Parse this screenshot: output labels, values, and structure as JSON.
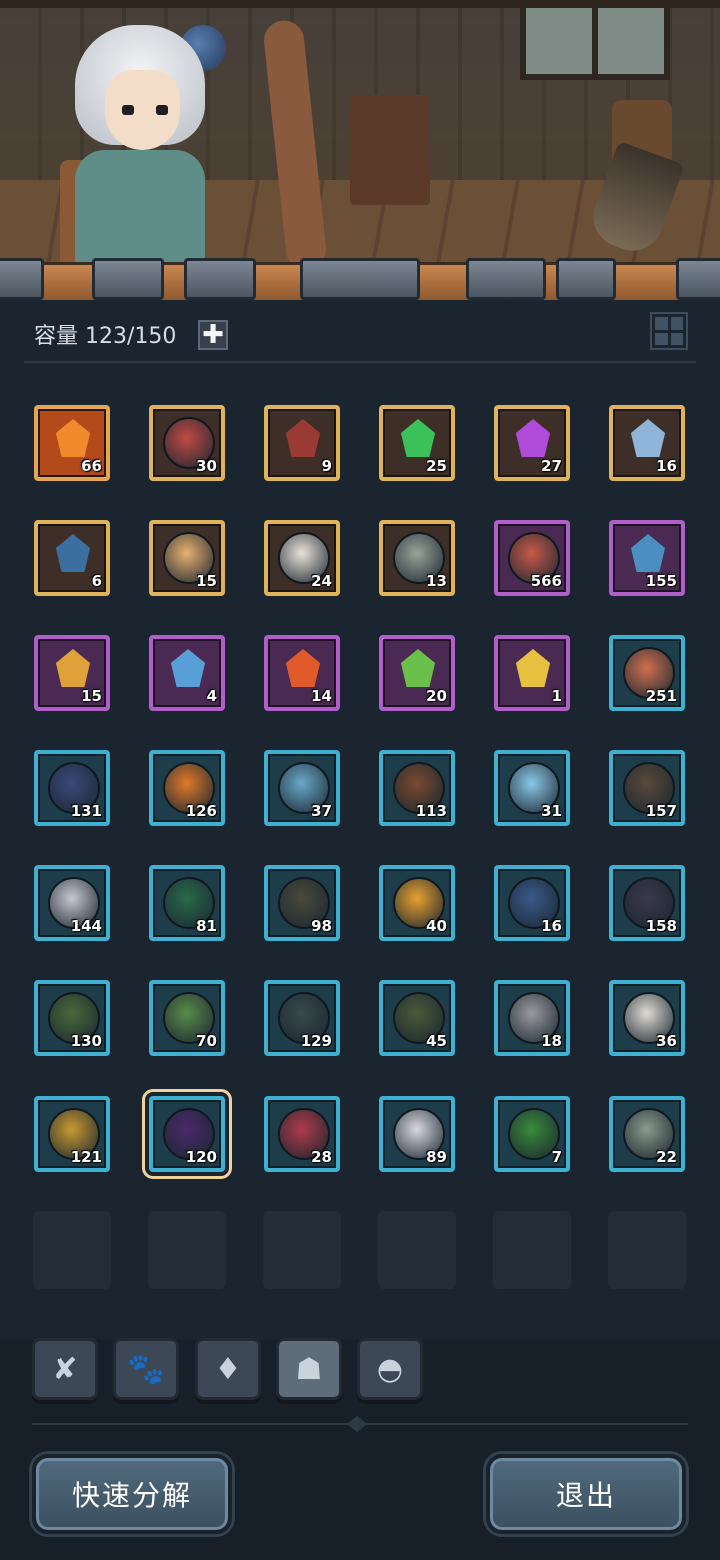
{
  "header": {
    "capacity_label": "容量 123/150",
    "add_symbol": "✚"
  },
  "tabs": [
    {
      "name": "weapon-icon",
      "glyph": "✘"
    },
    {
      "name": "paw-icon",
      "glyph": "🐾"
    },
    {
      "name": "diamond-icon",
      "glyph": "♦"
    },
    {
      "name": "material-icon",
      "glyph": "☗"
    },
    {
      "name": "chest-icon",
      "glyph": "◓"
    }
  ],
  "active_tab": 3,
  "items": [
    {
      "rarity": "orange",
      "kind": "fire-essence",
      "color": "#f08a2c",
      "shape": "gem",
      "count": "66"
    },
    {
      "rarity": "gold",
      "kind": "meat-stack",
      "color": "#c24a44",
      "shape": "orb",
      "count": "30"
    },
    {
      "rarity": "gold",
      "kind": "red-ore",
      "color": "#9a3a35",
      "shape": "gem",
      "count": "9"
    },
    {
      "rarity": "gold",
      "kind": "green-crystal",
      "color": "#3cc05a",
      "shape": "gem",
      "count": "25"
    },
    {
      "rarity": "gold",
      "kind": "purple-flame",
      "color": "#b04ad8",
      "shape": "gem",
      "count": "27"
    },
    {
      "rarity": "gold",
      "kind": "blue-shard",
      "color": "#8fb6d8",
      "shape": "gem",
      "count": "16"
    },
    {
      "rarity": "gold",
      "kind": "blue-star-crystal",
      "color": "#3a6fa0",
      "shape": "gem",
      "count": "6"
    },
    {
      "rarity": "gold",
      "kind": "hero-girl-portrait",
      "color": "#e8b070",
      "shape": "orb",
      "count": "15"
    },
    {
      "rarity": "gold",
      "kind": "white-hero-portrait",
      "color": "#e9e3d9",
      "shape": "orb",
      "count": "24"
    },
    {
      "rarity": "gold",
      "kind": "rat-portrait",
      "color": "#9aa49a",
      "shape": "orb",
      "count": "13"
    },
    {
      "rarity": "purple",
      "kind": "meat-drumstick",
      "color": "#c85a48",
      "shape": "orb",
      "count": "566"
    },
    {
      "rarity": "purple",
      "kind": "map-scroll",
      "color": "#4a8fc0",
      "shape": "gem",
      "count": "155"
    },
    {
      "rarity": "purple",
      "kind": "amber-ore",
      "color": "#e0a03a",
      "shape": "gem",
      "count": "15"
    },
    {
      "rarity": "purple",
      "kind": "water-drop",
      "color": "#5aa0d8",
      "shape": "gem",
      "count": "4"
    },
    {
      "rarity": "purple",
      "kind": "fire-essence",
      "color": "#e05a2a",
      "shape": "gem",
      "count": "14"
    },
    {
      "rarity": "purple",
      "kind": "green-crystal",
      "color": "#6ac04a",
      "shape": "gem",
      "count": "20"
    },
    {
      "rarity": "purple",
      "kind": "gold-star",
      "color": "#e8c040",
      "shape": "gem",
      "count": "1"
    },
    {
      "rarity": "teal",
      "kind": "meat-drumstick",
      "color": "#d07050",
      "shape": "orb",
      "count": "251"
    },
    {
      "rarity": "teal",
      "kind": "wizard-portrait",
      "color": "#3a4a7a",
      "shape": "orb",
      "count": "131"
    },
    {
      "rarity": "teal",
      "kind": "fire-spirit-portrait",
      "color": "#e07a2a",
      "shape": "orb",
      "count": "126"
    },
    {
      "rarity": "teal",
      "kind": "ice-orb-portrait",
      "color": "#6aa8c8",
      "shape": "orb",
      "count": "37"
    },
    {
      "rarity": "teal",
      "kind": "griffin-portrait",
      "color": "#7a4a30",
      "shape": "orb",
      "count": "113"
    },
    {
      "rarity": "teal",
      "kind": "ice-golem-portrait",
      "color": "#8ac8e8",
      "shape": "orb",
      "count": "31"
    },
    {
      "rarity": "teal",
      "kind": "treant-portrait",
      "color": "#5a4a3a",
      "shape": "orb",
      "count": "157"
    },
    {
      "rarity": "teal",
      "kind": "crow-portrait",
      "color": "#c8c8d0",
      "shape": "orb",
      "count": "144"
    },
    {
      "rarity": "teal",
      "kind": "serpent-portrait",
      "color": "#2a6a4a",
      "shape": "orb",
      "count": "81"
    },
    {
      "rarity": "teal",
      "kind": "cat-beast-portrait",
      "color": "#4a4a3a",
      "shape": "orb",
      "count": "98"
    },
    {
      "rarity": "teal",
      "kind": "flame-fox-portrait",
      "color": "#e8a030",
      "shape": "orb",
      "count": "40"
    },
    {
      "rarity": "teal",
      "kind": "hero-girl-portrait",
      "color": "#3a5a8a",
      "shape": "orb",
      "count": "16"
    },
    {
      "rarity": "teal",
      "kind": "dark-dragon-portrait",
      "color": "#3a3a4a",
      "shape": "orb",
      "count": "158"
    },
    {
      "rarity": "teal",
      "kind": "scarecrow-portrait",
      "color": "#4a6a3a",
      "shape": "orb",
      "count": "130"
    },
    {
      "rarity": "teal",
      "kind": "dryad-portrait",
      "color": "#5a8a4a",
      "shape": "orb",
      "count": "70"
    },
    {
      "rarity": "teal",
      "kind": "elf-portrait",
      "color": "#3a4a4a",
      "shape": "orb",
      "count": "129"
    },
    {
      "rarity": "teal",
      "kind": "treant-portrait",
      "color": "#4a5a3a",
      "shape": "orb",
      "count": "45"
    },
    {
      "rarity": "teal",
      "kind": "mummy-portrait",
      "color": "#9a9aa0",
      "shape": "orb",
      "count": "18"
    },
    {
      "rarity": "teal",
      "kind": "white-hero-portrait",
      "color": "#e0dcd4",
      "shape": "orb",
      "count": "36"
    },
    {
      "rarity": "teal",
      "kind": "wyvern-portrait",
      "color": "#c89a30",
      "shape": "orb",
      "count": "121"
    },
    {
      "rarity": "teal",
      "kind": "shadow-beast-portrait",
      "color": "#4a2a6a",
      "shape": "orb",
      "count": "120",
      "selected": true
    },
    {
      "rarity": "teal",
      "kind": "red-drake-portrait",
      "color": "#b03a4a",
      "shape": "orb",
      "count": "28"
    },
    {
      "rarity": "teal",
      "kind": "white-wolf-portrait",
      "color": "#d8d8e0",
      "shape": "orb",
      "count": "89"
    },
    {
      "rarity": "teal",
      "kind": "vine-orb-portrait",
      "color": "#3a8a3a",
      "shape": "orb",
      "count": "7"
    },
    {
      "rarity": "teal",
      "kind": "rat-portrait",
      "color": "#8a9a8a",
      "shape": "orb",
      "count": "22"
    }
  ],
  "empty_slots": 6,
  "buttons": {
    "quick_decompose": "快速分解",
    "exit": "退出"
  },
  "colors": {
    "background": "#1b2530",
    "rarity_gold": "#dfb35a",
    "rarity_orange": "#e3a552",
    "rarity_purple": "#b05fc8",
    "rarity_teal": "#3fb0d0",
    "selected_outline": "#efd39a"
  }
}
